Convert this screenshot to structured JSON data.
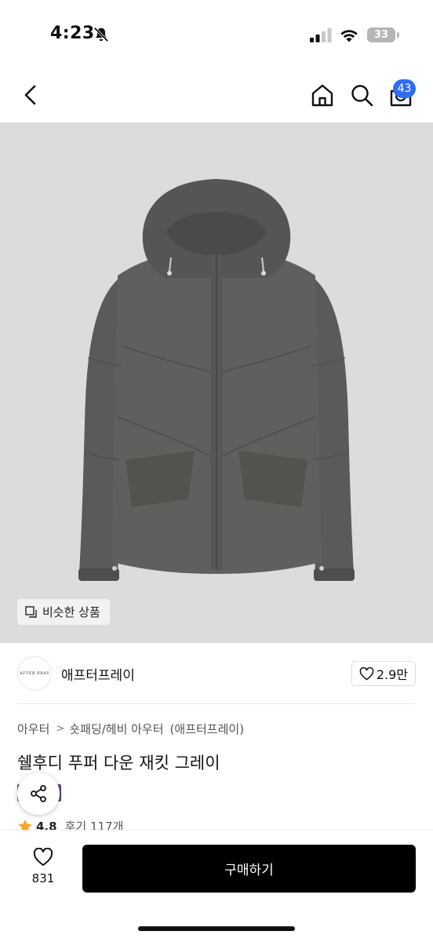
{
  "status_bar": {
    "time": "4:23",
    "battery": "33",
    "icons": [
      "bell-off-icon",
      "signal-icon",
      "wifi-icon",
      "battery-icon"
    ]
  },
  "nav": {
    "cart_count": "43",
    "icons": [
      "back-chevron-icon",
      "home-icon",
      "search-icon",
      "cart-icon"
    ]
  },
  "product_image": {
    "jacket_color": "#5a5b58",
    "background": "#dcdcdc",
    "similar_label": "비슷한 상품"
  },
  "brand": {
    "logo_text": "AFTER PRAY",
    "name": "애프터프레이",
    "likes": "2.9만"
  },
  "breadcrumb": {
    "category1": "아우터",
    "separator": ">",
    "category2": "숏패딩/헤비 아우터",
    "brand": "(애프터프레이)"
  },
  "product": {
    "title": "쉘후디 푸퍼 다운 재킷 그레이",
    "tag": "세일",
    "rating": "4.8",
    "reviews": "후기 117개"
  },
  "bottom": {
    "wish_count": "831",
    "buy_label": "구매하기"
  },
  "colors": {
    "accent_badge": "#2f6cf6",
    "tag_bg": "#5a4b7a",
    "star": "#f5a623",
    "buy_bg": "#000000"
  }
}
